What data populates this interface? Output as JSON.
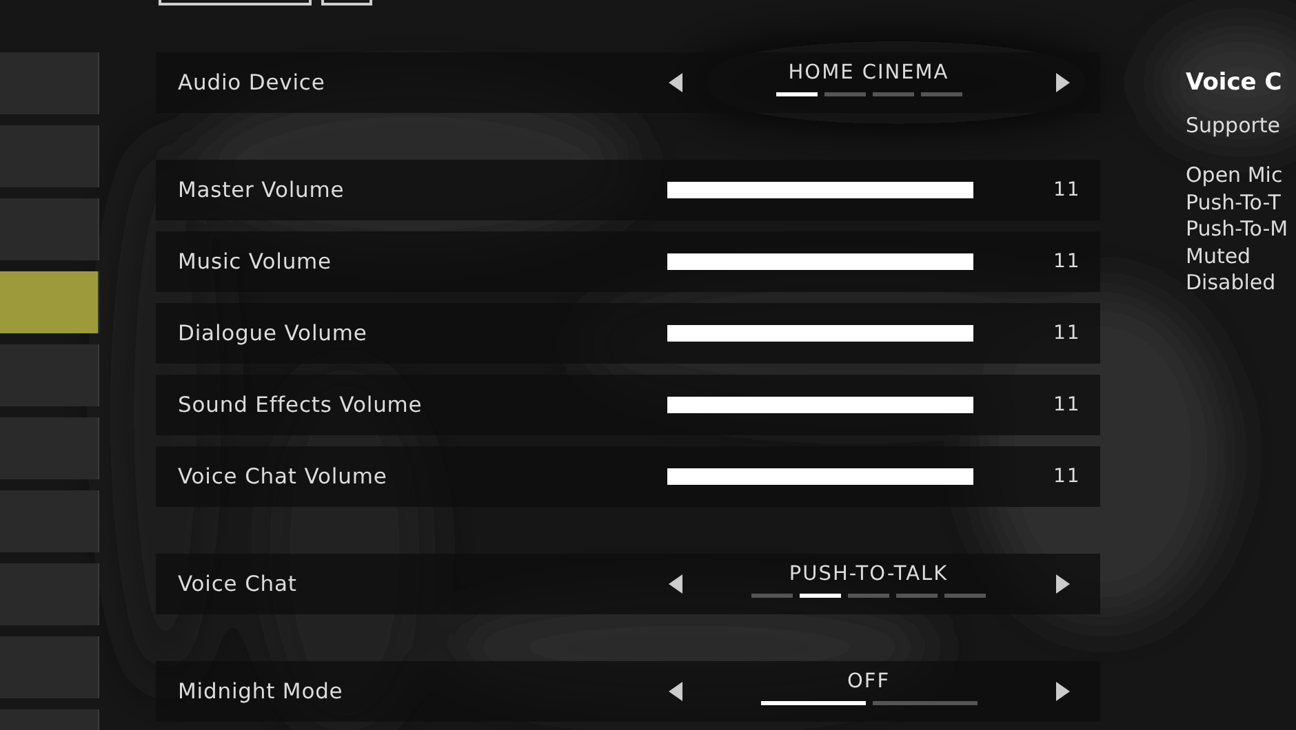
{
  "sidebar": {
    "items": [
      {
        "selected": false
      },
      {
        "selected": false
      },
      {
        "selected": false
      },
      {
        "selected": true
      },
      {
        "selected": false
      },
      {
        "selected": false
      },
      {
        "selected": false
      },
      {
        "selected": false
      },
      {
        "selected": false
      },
      {
        "selected": false
      }
    ]
  },
  "settings": [
    {
      "kind": "selector",
      "label": "Audio Device",
      "value": "HOME CINEMA",
      "options": [
        {
          "selected": true
        },
        {
          "selected": false
        },
        {
          "selected": false
        },
        {
          "selected": false
        }
      ]
    },
    {
      "kind": "gap"
    },
    {
      "kind": "slider",
      "label": "Master Volume",
      "level": 1,
      "reading": "11"
    },
    {
      "kind": "slider",
      "label": "Music Volume",
      "level": 1,
      "reading": "11"
    },
    {
      "kind": "slider",
      "label": "Dialogue Volume",
      "level": 1,
      "reading": "11"
    },
    {
      "kind": "slider",
      "label": "Sound Effects Volume",
      "level": 1,
      "reading": "11"
    },
    {
      "kind": "slider",
      "label": "Voice Chat Volume",
      "level": 1,
      "reading": "11"
    },
    {
      "kind": "gap"
    },
    {
      "kind": "selector",
      "label": "Voice Chat",
      "value": "PUSH-TO-TALK",
      "options": [
        {
          "selected": false
        },
        {
          "selected": true
        },
        {
          "selected": false
        },
        {
          "selected": false
        },
        {
          "selected": false
        }
      ]
    },
    {
      "kind": "gap"
    },
    {
      "kind": "selector",
      "label": "Midnight Mode",
      "value": "OFF",
      "options": [
        {
          "selected": true
        },
        {
          "selected": false
        }
      ]
    }
  ],
  "info_panel": {
    "title": "Voice C",
    "subtitle": "Supporte",
    "lines": [
      "Open Mic",
      "Push-To-T",
      "Push-To-M",
      "Muted",
      "Disabled"
    ]
  }
}
